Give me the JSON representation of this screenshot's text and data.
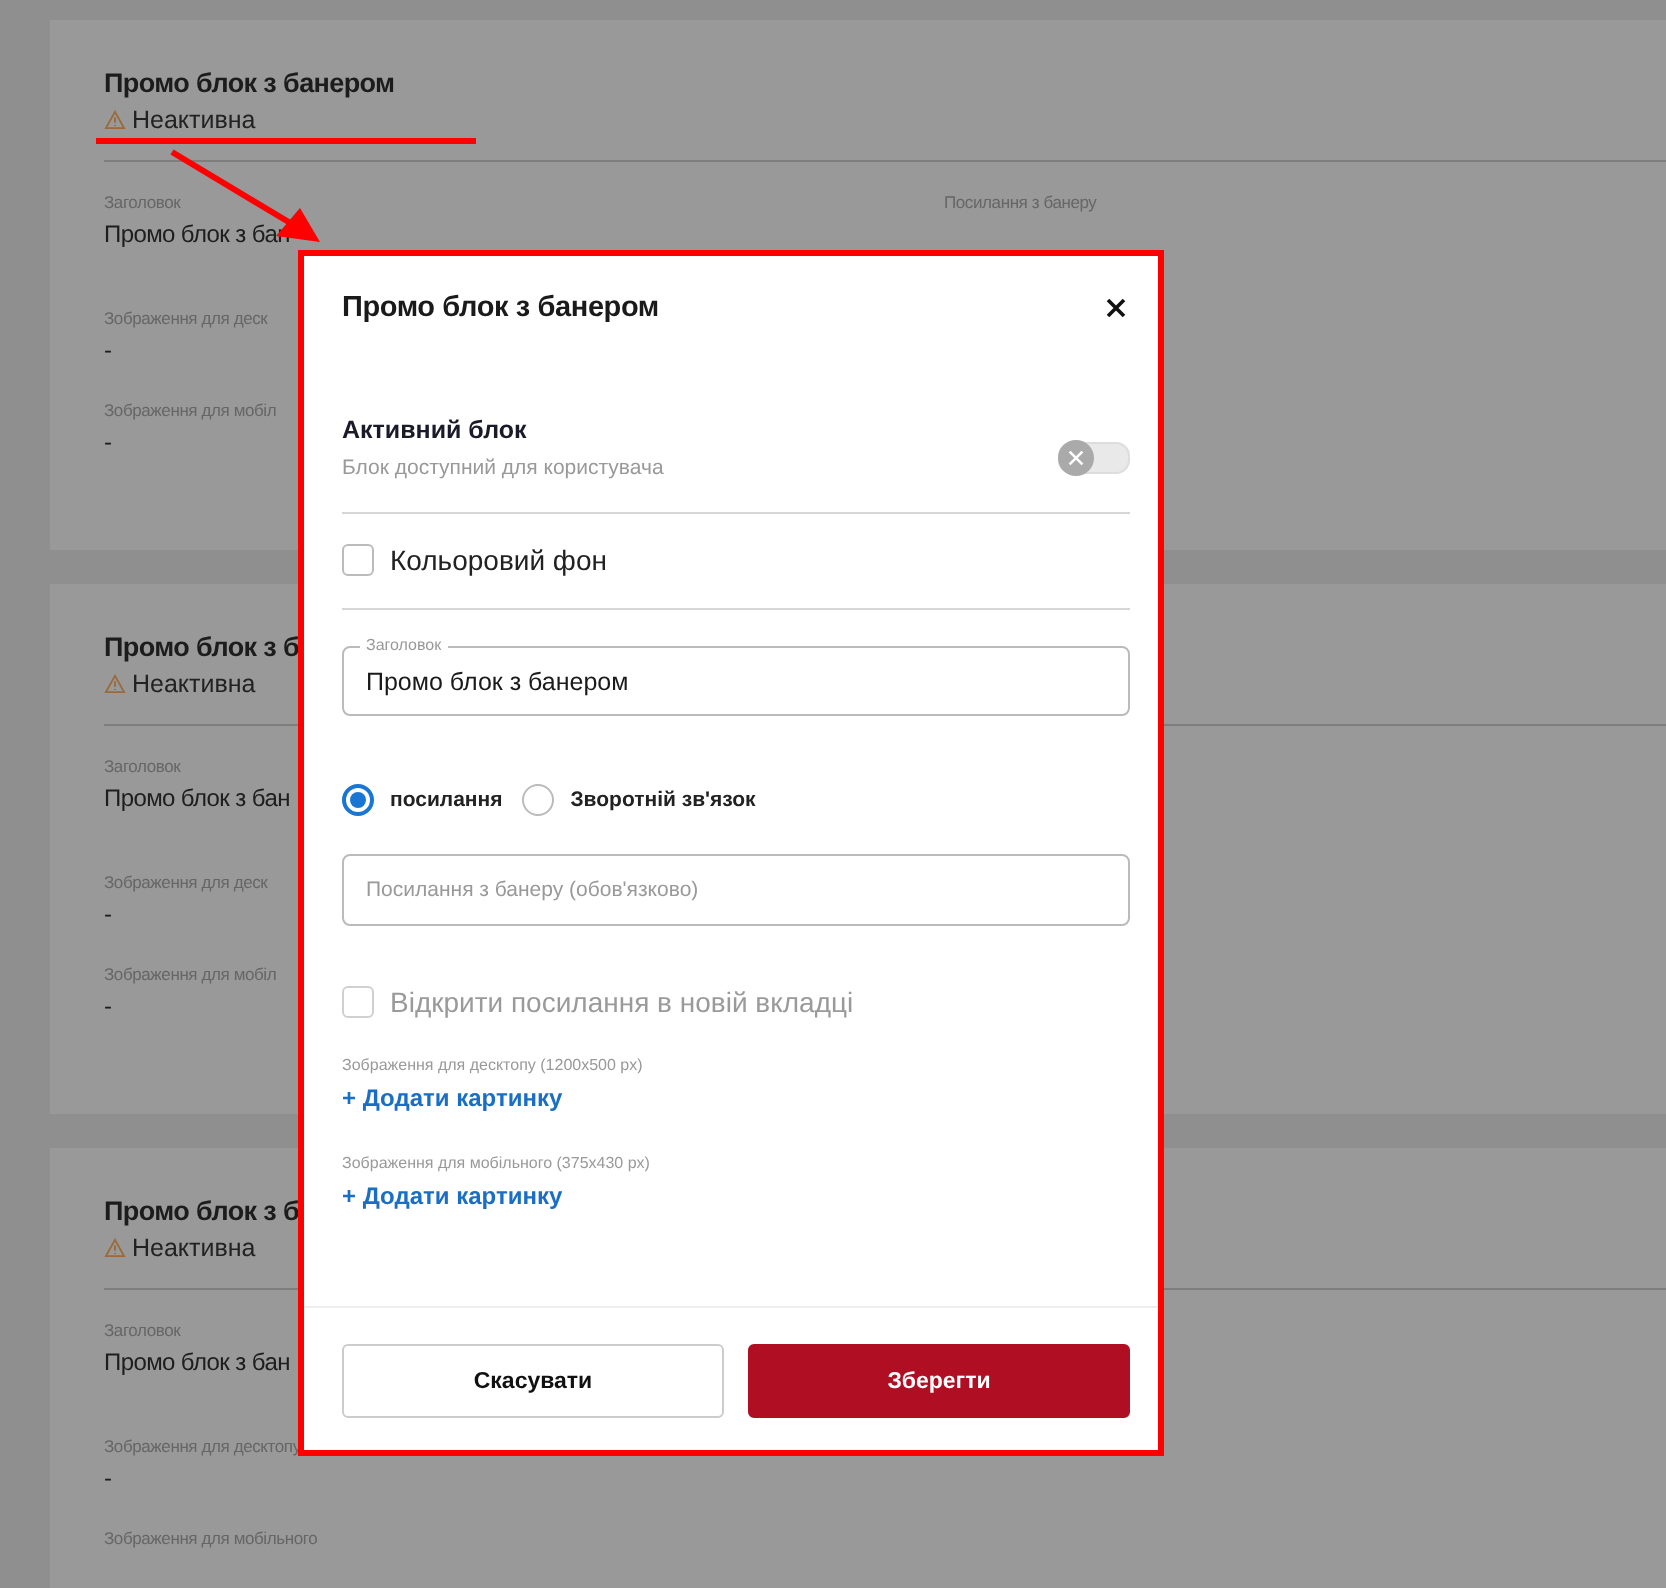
{
  "background_cards": [
    {
      "title": "Промо блок з банером",
      "status": "Неактивна",
      "title_label": "Заголовок",
      "title_value": "Промо блок з бан",
      "link_label": "Посилання з банеру",
      "images": [
        {
          "label": "Зображення для деск",
          "value": "-"
        },
        {
          "label": "Зображення для мобіл",
          "value": "-"
        }
      ]
    },
    {
      "title": "Промо блок з б",
      "status": "Неактивна",
      "title_label": "Заголовок",
      "title_value": "Промо блок з бан",
      "images": [
        {
          "label": "Зображення для деск",
          "value": "-"
        },
        {
          "label": "Зображення для мобіл",
          "value": "-"
        }
      ]
    },
    {
      "title": "Промо блок з б",
      "status": "Неактивна",
      "title_label": "Заголовок",
      "title_value": "Промо блок з бан",
      "images": [
        {
          "label": "Зображення для десктопу",
          "value": "-"
        },
        {
          "label": "Зображення для мобільного"
        }
      ]
    }
  ],
  "modal": {
    "title": "Промо блок з банером",
    "active_toggle": {
      "label": "Активний блок",
      "description": "Блок доступний для користувача",
      "on": false
    },
    "colored_background": {
      "label": "Кольоровий фон",
      "checked": false
    },
    "title_field": {
      "label": "Заголовок",
      "value": "Промо блок з банером"
    },
    "link_type": [
      {
        "label": "посилання",
        "selected": true
      },
      {
        "label": "Зворотній зв'язок",
        "selected": false
      }
    ],
    "link_field": {
      "placeholder": "Посилання з банеру (обов'язково)"
    },
    "new_tab": {
      "label": "Відкрити посилання в новій вкладці",
      "checked": false,
      "disabled": true
    },
    "images": [
      {
        "label": "Зображення для десктопу (1200x500 px)",
        "action": "+ Додати картинку"
      },
      {
        "label": "Зображення для мобільного (375x430 px)",
        "action": "+ Додати картинку"
      }
    ],
    "buttons": [
      {
        "label": "Скасувати",
        "kind": "secondary"
      },
      {
        "label": "Зберегти",
        "kind": "primary"
      }
    ]
  }
}
